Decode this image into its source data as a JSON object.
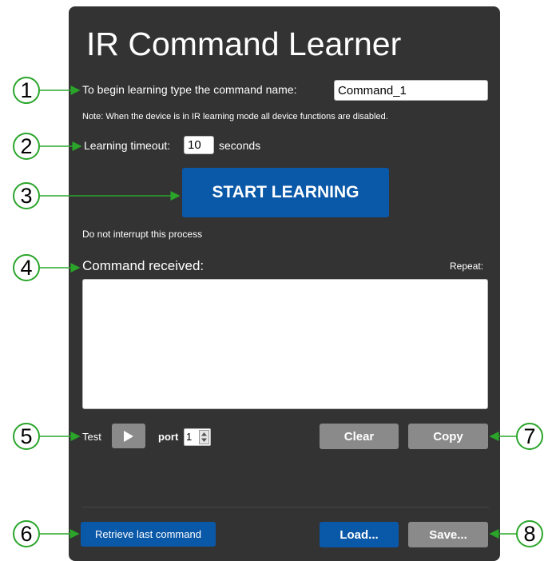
{
  "title": "IR Command Learner",
  "command_name": {
    "label": "To begin learning type the command name:",
    "value": "Command_1"
  },
  "note": "Note: When the device is in IR learning mode all device functions are disabled.",
  "timeout": {
    "label": "Learning timeout:",
    "value": "10",
    "unit": "seconds"
  },
  "start_button": "START LEARNING",
  "interrupt_note": "Do not interrupt this process",
  "command_received": {
    "label": "Command received:",
    "repeat_label": "Repeat:",
    "value": ""
  },
  "test": {
    "label": "Test",
    "port_label": "port",
    "port_value": "1"
  },
  "buttons": {
    "clear": "Clear",
    "copy": "Copy",
    "retrieve": "Retrieve last command",
    "load": "Load...",
    "save": "Save..."
  },
  "callouts": [
    "1",
    "2",
    "3",
    "4",
    "5",
    "6",
    "7",
    "8"
  ],
  "colors": {
    "panel": "#333333",
    "primary_button": "#0a58a8",
    "secondary_button": "#8a8a8a",
    "callout_arrow": "#2aa52a"
  },
  "icons": {
    "play": "play-icon",
    "spinner": "spinner-arrows-icon"
  }
}
